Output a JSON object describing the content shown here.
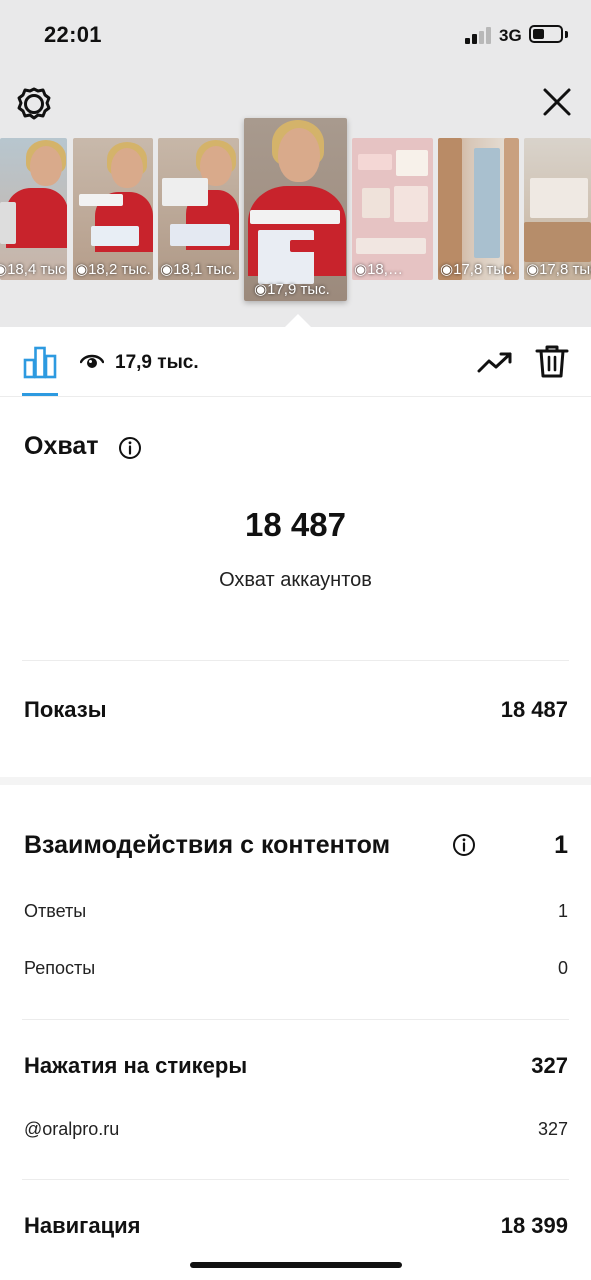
{
  "status_bar": {
    "time": "22:01",
    "network": "3G",
    "signal_bars_filled": 2,
    "signal_bars_total": 4
  },
  "header": {
    "settings_icon": "gear-icon",
    "close_icon": "close-icon"
  },
  "stories": [
    {
      "views": "18,4 тыс."
    },
    {
      "views": "18,2 тыс."
    },
    {
      "views": "18,1 тыс."
    },
    {
      "views": "17,9 тыс.",
      "active": true
    },
    {
      "views": "18,…"
    },
    {
      "views": "17,8 тыс."
    },
    {
      "views": "17,8 тыс."
    }
  ],
  "tabs": {
    "active_tab_icon": "bar-chart-icon",
    "views_icon": "eye-icon",
    "views_count": "17,9 тыс.",
    "trend_icon": "trending-up-icon",
    "delete_icon": "trash-icon",
    "accent": "#2d9ae0"
  },
  "reach": {
    "title": "Охват",
    "value": "18 487",
    "label": "Охват аккаунтов"
  },
  "impressions": {
    "label": "Показы",
    "value": "18 487"
  },
  "interactions": {
    "title": "Взаимодействия с контентом",
    "value": "1",
    "rows": [
      {
        "label": "Ответы",
        "value": "1"
      },
      {
        "label": "Репосты",
        "value": "0"
      }
    ]
  },
  "sticker_taps": {
    "title": "Нажатия на стикеры",
    "value": "327",
    "rows": [
      {
        "label": "@oralpro.ru",
        "value": "327"
      }
    ]
  },
  "navigation": {
    "title": "Навигация",
    "value": "18 399"
  }
}
